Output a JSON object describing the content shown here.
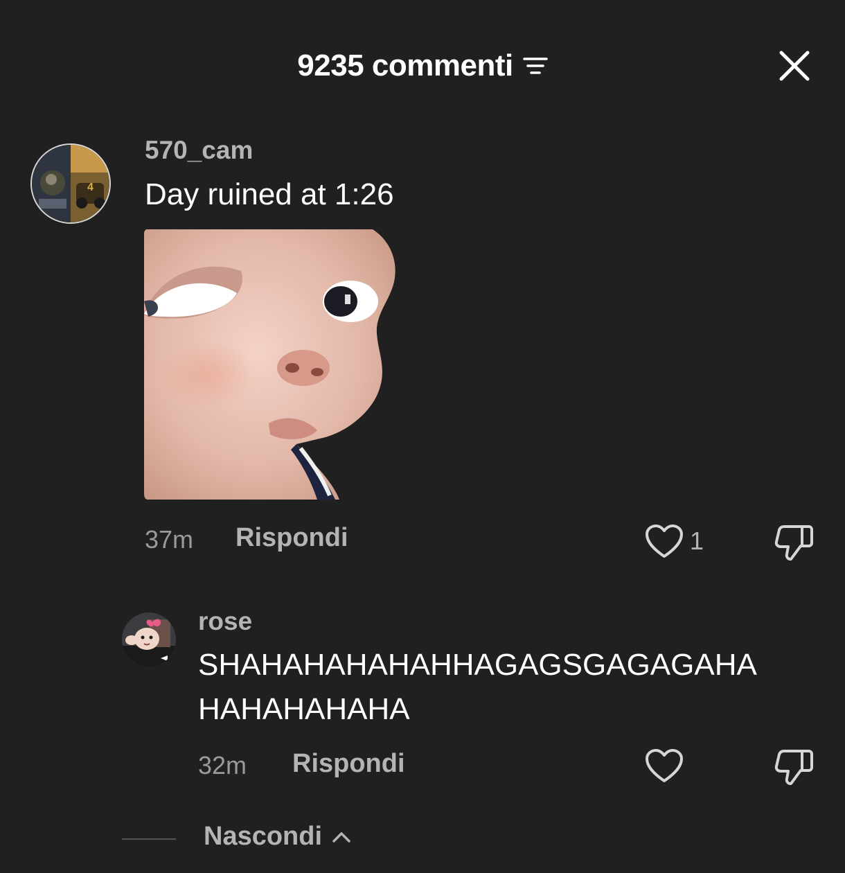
{
  "header": {
    "title": "9235 commenti",
    "sort_icon": "sort-lines-icon",
    "close_icon": "close-x-icon"
  },
  "comments": [
    {
      "username": "570_cam",
      "text": "Day ruined at 1:26",
      "sticker": "baby-face-sticker",
      "time": "37m",
      "reply_label": "Rispondi",
      "likes": "1"
    },
    {
      "username": "rose",
      "text_line1": "SHAHAHAHAHAHHAGAGSGAGAGAHA",
      "text_line2": "HAHAHAHAHA",
      "time": "32m",
      "reply_label": "Rispondi",
      "likes": ""
    }
  ],
  "hide_label": "Nascondi",
  "colors": {
    "background": "#202020",
    "text_primary": "#ffffff",
    "text_secondary": "#b4b4b4"
  }
}
